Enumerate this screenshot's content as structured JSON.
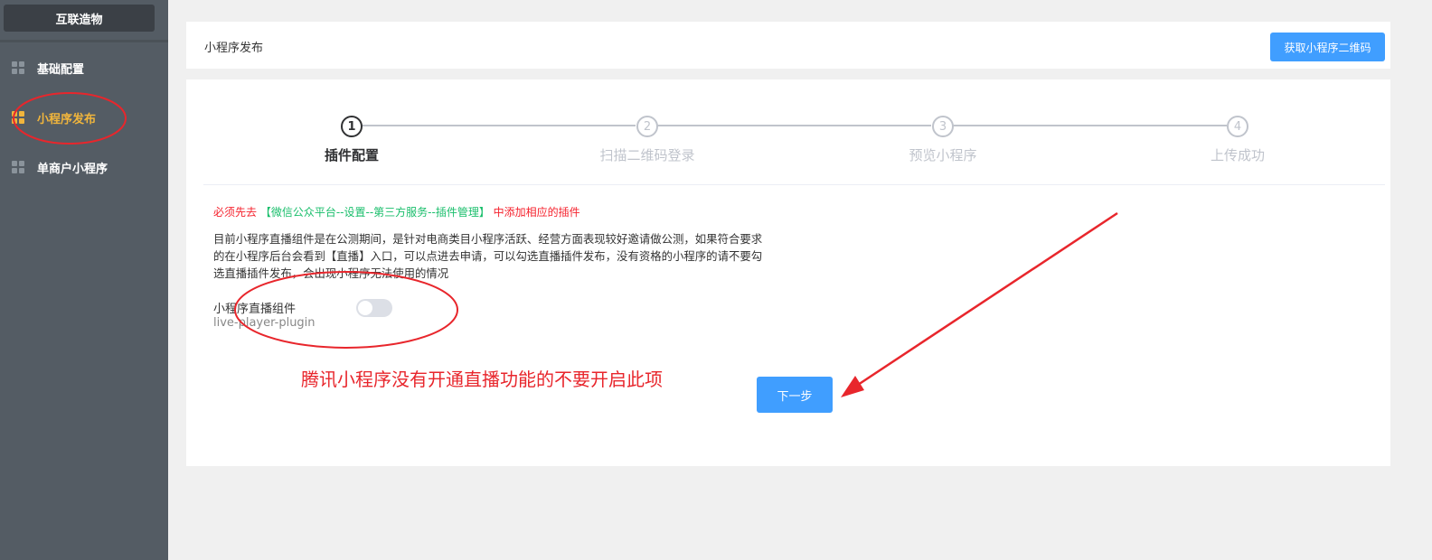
{
  "sidebar": {
    "brand": "互联造物",
    "items": [
      {
        "label": "基础配置",
        "active": false
      },
      {
        "label": "小程序发布",
        "active": true
      },
      {
        "label": "单商户小程序",
        "active": false
      }
    ]
  },
  "header": {
    "title": "小程序发布",
    "qr_button": "获取小程序二维码"
  },
  "steps": [
    {
      "number": "1",
      "label": "插件配置",
      "active": true
    },
    {
      "number": "2",
      "label": "扫描二维码登录",
      "active": false
    },
    {
      "number": "3",
      "label": "预览小程序",
      "active": false
    },
    {
      "number": "4",
      "label": "上传成功",
      "active": false
    }
  ],
  "notice": {
    "prefix": "必须先去",
    "path": "【微信公众平台--设置--第三方服务--插件管理】",
    "suffix": "中添加相应的插件"
  },
  "description": "目前小程序直播组件是在公测期间，是针对电商类目小程序活跃、经营方面表现较好邀请做公测，如果符合要求的在小程序后台会看到【直播】入口，可以点进去申请，可以勾选直播插件发布，没有资格的小程序的请不要勾选直播插件发布，会出现小程序无法使用的情况",
  "plugin": {
    "label": "小程序直播组件",
    "id": "live-player-plugin",
    "enabled": false
  },
  "annotation": "腾讯小程序没有开通直播功能的不要开启此项",
  "next_button": "下一步",
  "colors": {
    "sidebar_bg": "#545c64",
    "active": "#f0b53c",
    "primary": "#409eff",
    "annotation_red": "#e8262c",
    "notice_green": "#19be6b"
  }
}
